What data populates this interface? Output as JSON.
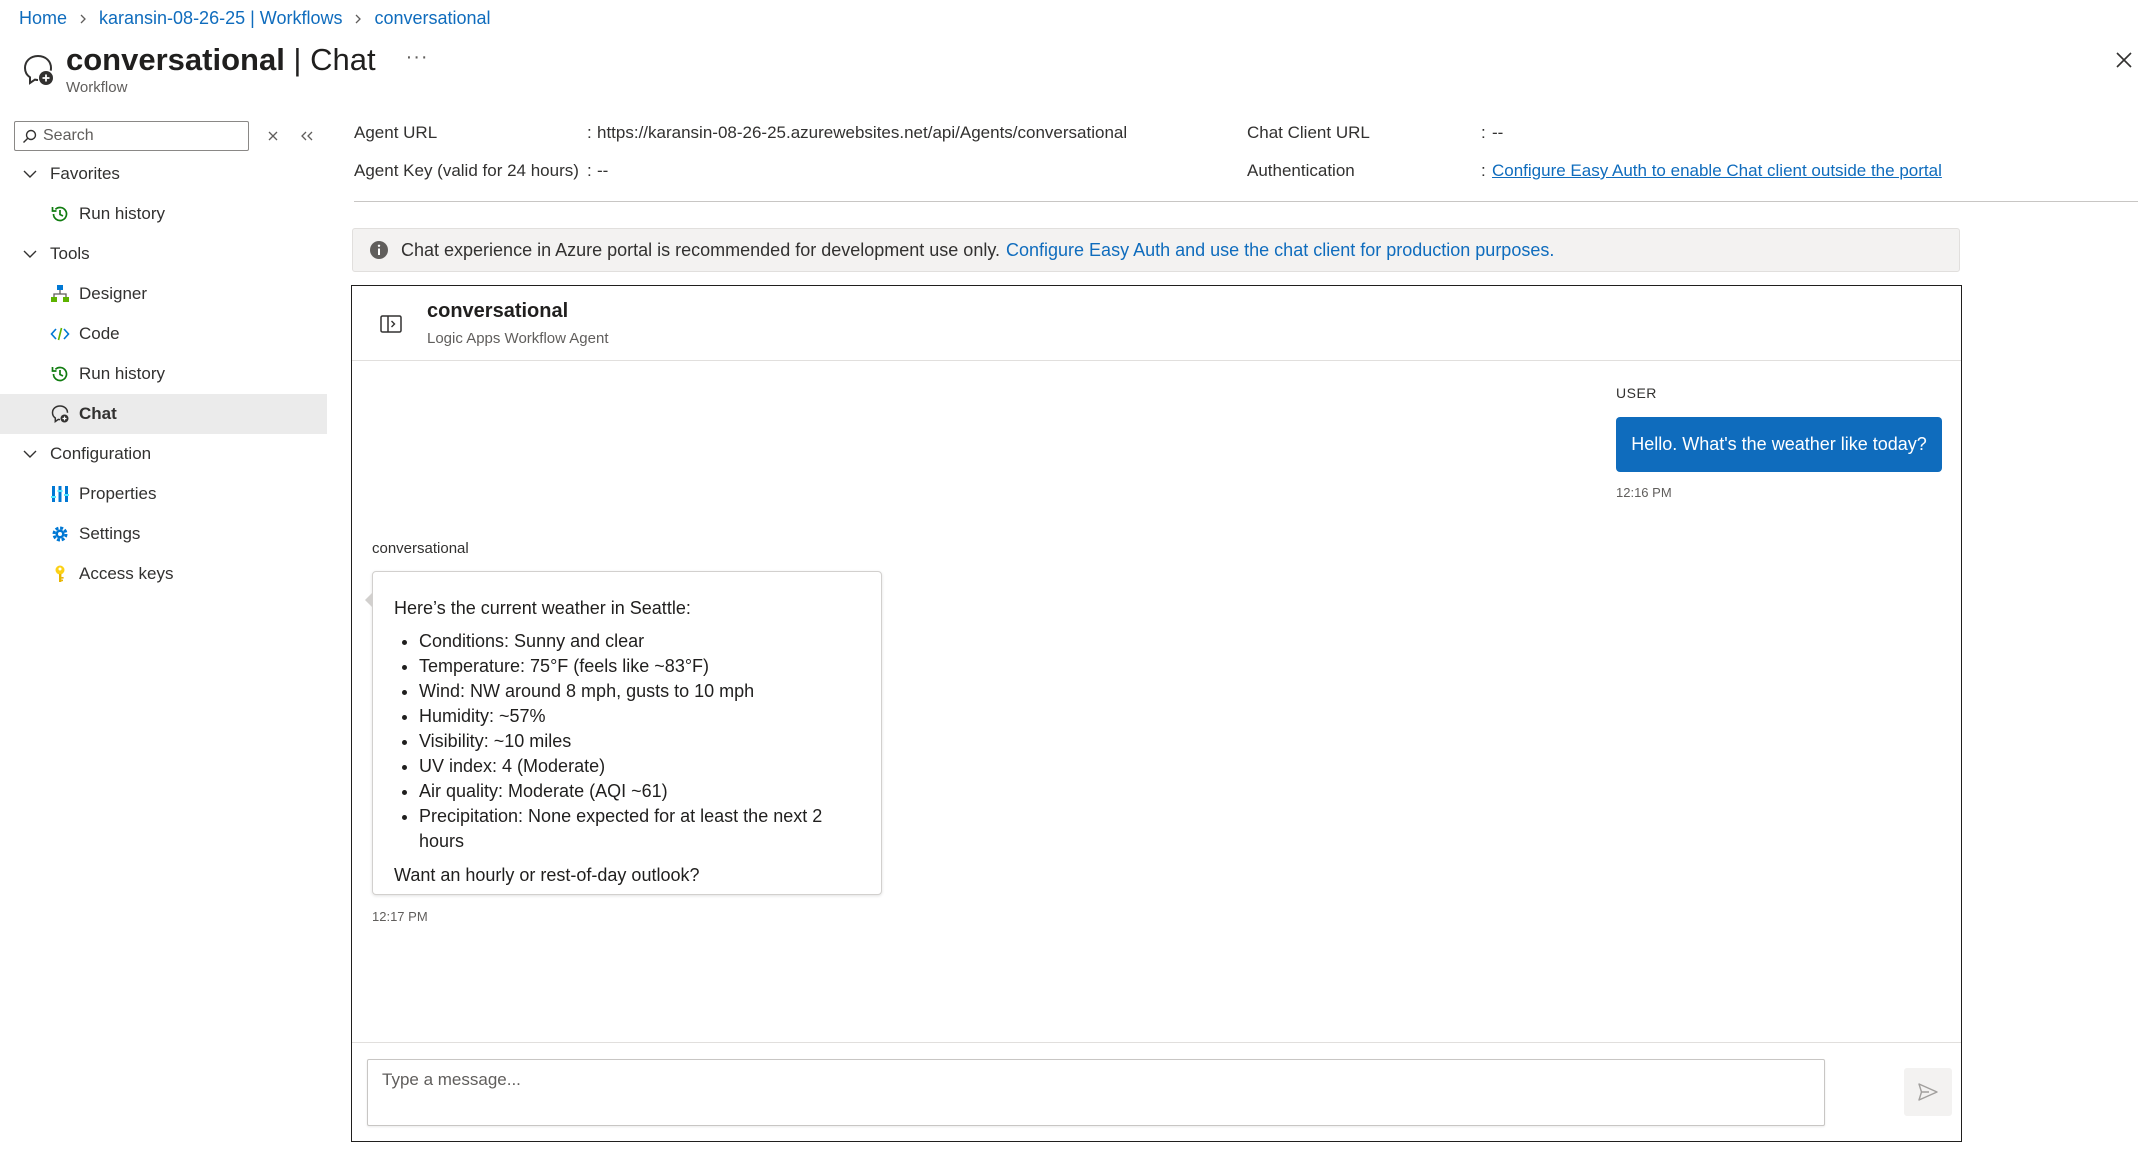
{
  "breadcrumb": {
    "home": "Home",
    "workflows": "karansin-08-26-25 | Workflows",
    "current": "conversational"
  },
  "header": {
    "title_bold": "conversational",
    "title_rest": " | Chat",
    "subtitle": "Workflow",
    "more": "···"
  },
  "sidebar": {
    "search_placeholder": "Search",
    "groups": {
      "favorites": "Favorites",
      "tools": "Tools",
      "configuration": "Configuration"
    },
    "items": {
      "fav_run_history": "Run history",
      "designer": "Designer",
      "code": "Code",
      "run_history": "Run history",
      "chat": "Chat",
      "properties": "Properties",
      "settings": "Settings",
      "access_keys": "Access keys"
    }
  },
  "info": {
    "agent_url_label": "Agent URL",
    "agent_url_value": "https://karansin-08-26-25.azurewebsites.net/api/Agents/conversational",
    "agent_key_label": "Agent Key (valid for 24 hours)",
    "agent_key_value": "--",
    "chat_client_url_label": "Chat Client URL",
    "chat_client_url_value": "--",
    "authentication_label": "Authentication",
    "authentication_link": "Configure Easy Auth to enable Chat client outside the portal",
    "colon": ":"
  },
  "banner": {
    "text": "Chat experience in Azure portal is recommended for development use only.",
    "link": "Configure Easy Auth and use the chat client for production purposes."
  },
  "chat": {
    "agent_name": "conversational",
    "agent_subtitle": "Logic Apps Workflow Agent",
    "user_label": "USER",
    "user_message": "Hello. What's the weather like today?",
    "user_time": "12:16 PM",
    "bot_label": "conversational",
    "bot_intro": "Here’s the current weather in Seattle:",
    "bot_items": [
      "Conditions: Sunny and clear",
      "Temperature: 75°F (feels like ~83°F)",
      "Wind: NW around 8 mph, gusts to 10 mph",
      "Humidity: ~57%",
      "Visibility: ~10 miles",
      "UV index: 4 (Moderate)",
      "Air quality: Moderate (AQI ~61)",
      "Precipitation: None expected for at least the next 2 hours"
    ],
    "bot_outro": "Want an hourly or rest-of-day outlook?",
    "bot_time": "12:17 PM",
    "input_placeholder": "Type a message..."
  },
  "icons": {
    "workflow_chat": "chat-workflow-icon",
    "close": "close-icon",
    "search": "search-icon",
    "info": "info-icon",
    "send": "send-icon",
    "panel": "panel-toggle-icon"
  },
  "colors": {
    "accent": "#0f6cbd",
    "selected_bg": "#ebebeb",
    "banner_bg": "#f3f2f1"
  }
}
